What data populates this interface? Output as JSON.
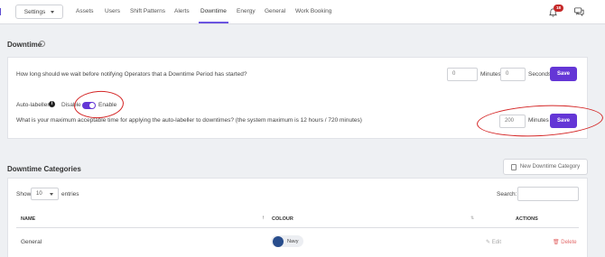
{
  "topnav": {
    "settings_label": "Settings",
    "tabs": [
      "Assets",
      "Users",
      "Shift Patterns",
      "Alerts",
      "Downtime",
      "Energy",
      "General",
      "Work Booking"
    ],
    "active_tab": "Downtime",
    "notification_count": "18"
  },
  "downtime": {
    "title": "Downtime",
    "notify_question": "How long should we wait before notifying Operators that a Downtime Period has started?",
    "minutes_value": "0",
    "minutes_label": "Minutes",
    "seconds_value": "0",
    "seconds_label": "Seconds",
    "save_label": "Save",
    "auto_labeller_label": "Auto-labeller",
    "disable_label": "Disable",
    "enable_label": "Enable",
    "auto_labeller_enabled": true,
    "max_time_question": "What is your maximum acceptable time for applying the auto-labeller to downtimes? (the system maximum is 12 hours / 720 minutes)",
    "max_minutes_value": "200",
    "max_minutes_label": "Minutes",
    "max_save_label": "Save"
  },
  "categories": {
    "title": "Downtime Categories",
    "new_button_label": "New Downtime Category",
    "show_label": "Show",
    "page_size": "10",
    "entries_label": "entries",
    "search_label": "Search:",
    "columns": {
      "name": "NAME",
      "colour": "COLOUR",
      "actions": "ACTIONS"
    },
    "rows": [
      {
        "name": "General",
        "colour_name": "Navy",
        "colour_hex": "#284d8c",
        "edit_label": "Edit",
        "delete_label": "Delete"
      }
    ]
  },
  "colors": {
    "accent": "#6436d6",
    "annotation": "#d42424",
    "badge": "#c52828"
  },
  "icons": [
    "bell-icon",
    "chat-icon",
    "info-icon",
    "document-icon",
    "pencil-icon",
    "trash-icon",
    "sort-icon"
  ]
}
